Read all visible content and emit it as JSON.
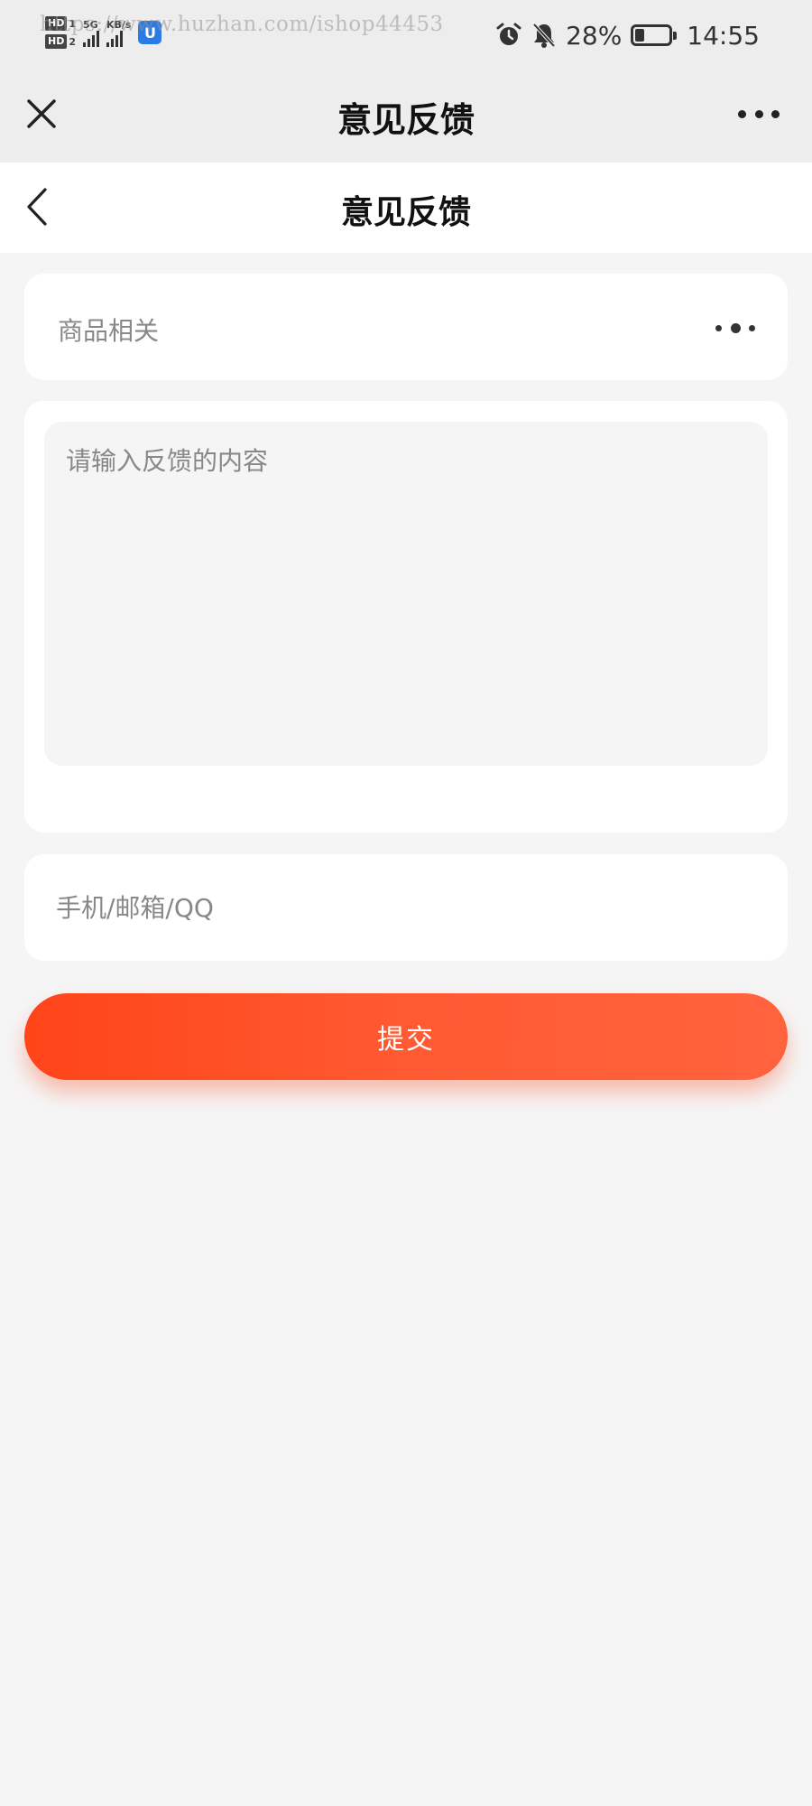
{
  "status_bar": {
    "network_badges": [
      "HD",
      "HD"
    ],
    "network_numbers": [
      "1",
      "2"
    ],
    "network_type": "5G",
    "network_speed": "KB/s",
    "app_badge": "U",
    "watermark": "https://www.huzhan.com/ishop44453",
    "battery_percent": "28%",
    "battery_level": 0.28,
    "time": "14:55"
  },
  "host_bar": {
    "title": "意见反馈"
  },
  "nav_bar": {
    "title": "意见反馈"
  },
  "form": {
    "category": {
      "value": "商品相关"
    },
    "content": {
      "placeholder": "请输入反馈的内容"
    },
    "contact": {
      "placeholder": "手机/邮箱/QQ"
    },
    "submit_label": "提交"
  },
  "colors": {
    "accent": "#ff4418",
    "accent_end": "#ff633d",
    "background": "#f5f5f5",
    "host_bar": "#ededed"
  }
}
